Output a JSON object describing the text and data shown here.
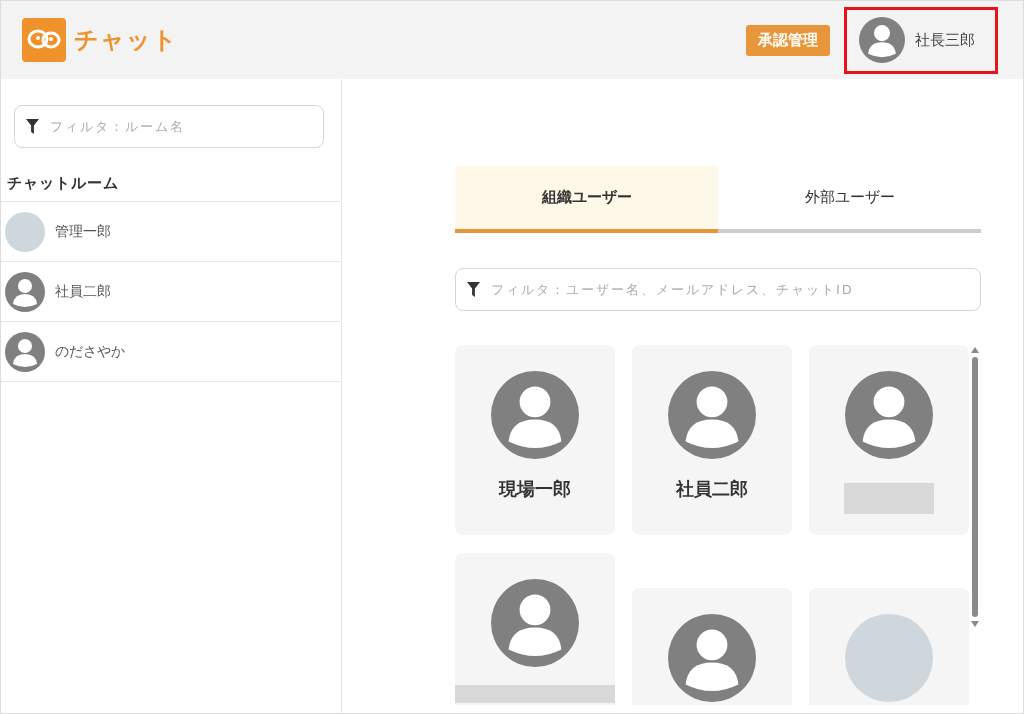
{
  "header": {
    "app_name": "チャット",
    "approval_button": "承認管理",
    "user": {
      "name": "社長三郎",
      "highlighted": true
    }
  },
  "sidebar": {
    "filter": {
      "placeholder": "フィルタ：ルーム名"
    },
    "heading": "チャットルーム",
    "rooms": [
      {
        "name": "管理一郎",
        "kind": "photo"
      },
      {
        "name": "社員二郎",
        "kind": "default"
      },
      {
        "name": "のださやか",
        "kind": "default"
      }
    ]
  },
  "tabs": [
    {
      "label": "組織ユーザー",
      "selected": true
    },
    {
      "label": "外部ユーザー",
      "selected": false
    }
  ],
  "user_filter": {
    "placeholder": "フィルタ：ユーザー名、メールアドレス、チャットID"
  },
  "users": [
    {
      "name": "現場一郎",
      "kind": "default",
      "name_hidden": false
    },
    {
      "name": "社員二郎",
      "kind": "default",
      "name_hidden": false
    },
    {
      "kind": "default",
      "name_hidden": true
    },
    {
      "kind": "default",
      "name_hidden": true
    },
    {
      "kind": "default",
      "name_hidden": false
    },
    {
      "kind": "photo",
      "name_hidden": false
    }
  ]
}
